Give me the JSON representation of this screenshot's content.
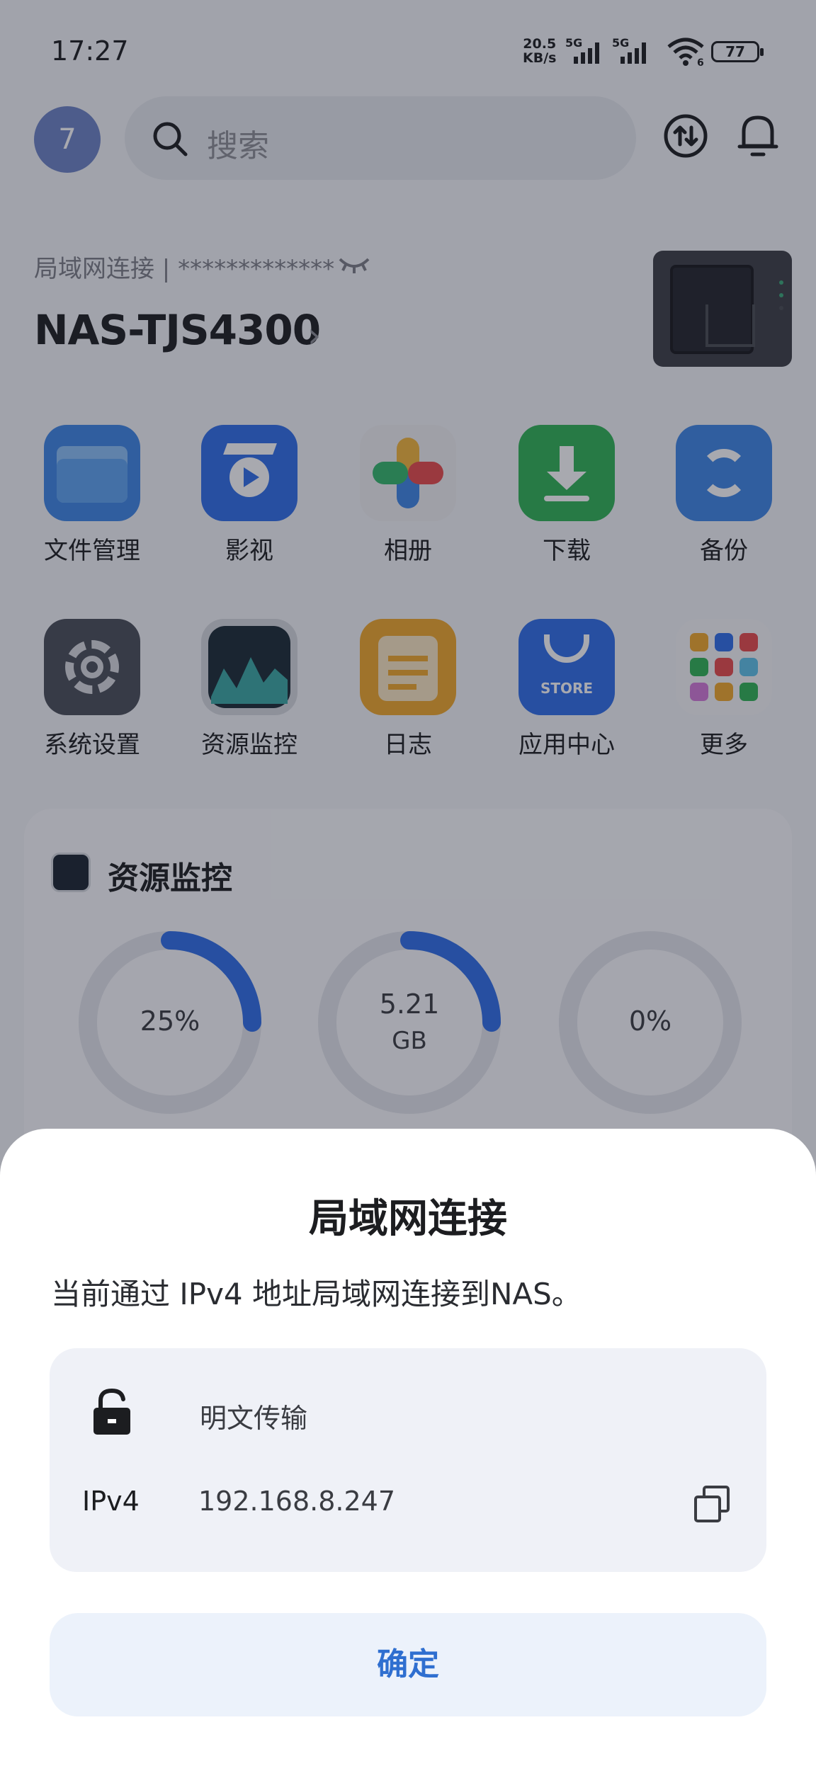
{
  "status_bar": {
    "time": "17:27",
    "net_speed_value": "20.5",
    "net_speed_unit": "KB/s",
    "signal_1": "5G",
    "signal_2": "5G",
    "wifi_badge": "6",
    "battery": "77"
  },
  "header": {
    "avatar_initial": "7",
    "search_placeholder": "搜索",
    "icons": [
      "search-icon",
      "transfer-icon",
      "bell-icon"
    ]
  },
  "device": {
    "connection": "局域网连接 | *************",
    "name": "NAS-TJS4300",
    "chevron": "›"
  },
  "apps": [
    {
      "label": "文件管理",
      "icon": "folder-icon",
      "color": "#3e86e6"
    },
    {
      "label": "影视",
      "icon": "video-icon",
      "color": "#2f6fe8"
    },
    {
      "label": "相册",
      "icon": "photos-icon",
      "color": "#f0f0f3"
    },
    {
      "label": "下载",
      "icon": "download-icon",
      "color": "#2fb455"
    },
    {
      "label": "备份",
      "icon": "backup-icon",
      "color": "#3e86e6"
    },
    {
      "label": "系统设置",
      "icon": "settings-icon",
      "color": "#4a4e58"
    },
    {
      "label": "资源监控",
      "icon": "monitor-icon",
      "color": "#1b2a34"
    },
    {
      "label": "日志",
      "icon": "log-icon",
      "color": "#f0a82b"
    },
    {
      "label": "应用中心",
      "icon": "store-icon",
      "color": "#2f6fe8",
      "badge": "STORE"
    },
    {
      "label": "更多",
      "icon": "more-icon",
      "color": "#f7f7f9"
    }
  ],
  "monitor": {
    "title": "资源监控",
    "gauges": [
      {
        "value": "25%",
        "fraction": 0.25
      },
      {
        "value": "5.21",
        "unit": "GB",
        "fraction": 0.25
      },
      {
        "value": "0%",
        "fraction": 0.0
      }
    ]
  },
  "sheet": {
    "title": "局域网连接",
    "description": "当前通过 IPv4 地址局域网连接到NAS。",
    "transport": "明文传输",
    "ip_label": "IPv4",
    "ip_value": "192.168.8.247",
    "ok": "确定"
  },
  "colors": {
    "accent": "#2f6fd0",
    "gauge_arc": "#2f6fe8",
    "dim": "rgba(25,30,45,0.38)"
  }
}
